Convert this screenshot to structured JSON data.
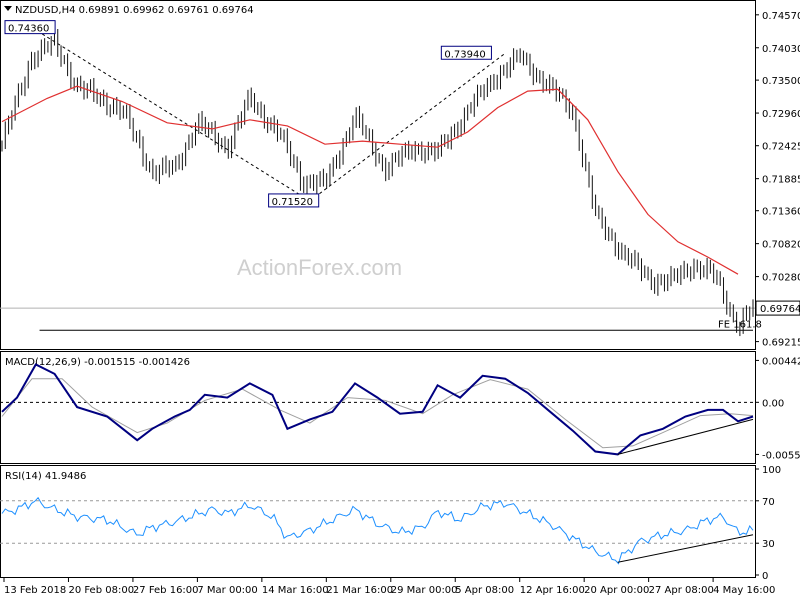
{
  "header": {
    "symbol_line": "NZDUSD,H4  0.69891 0.69962 0.69761 0.69764",
    "arrow_icon": "triangle-down-icon"
  },
  "watermark": "ActionForex.com",
  "chart_data": [
    {
      "type": "candlestick",
      "title": "NZDUSD,H4",
      "ohlc_last": {
        "open": 0.69891,
        "high": 0.69962,
        "low": 0.69761,
        "close": 0.69764
      },
      "y_ticks": [
        "0.74570",
        "0.74030",
        "0.73500",
        "0.72960",
        "0.72425",
        "0.71885",
        "0.71360",
        "0.70820",
        "0.70280",
        "0.69215"
      ],
      "ylim": [
        0.6911,
        0.7478
      ],
      "current_price_label": "0.69764",
      "current_price": 0.69764,
      "annotations": [
        {
          "label": "0.74360",
          "value": 0.7436
        },
        {
          "label": "0.71520",
          "value": 0.7152
        },
        {
          "label": "0.73940",
          "value": 0.7394
        },
        {
          "label": "FE 161.8",
          "value": 0.694
        }
      ],
      "series": [
        {
          "name": "price",
          "color": "#111111"
        },
        {
          "name": "moving average",
          "color": "#e03030"
        }
      ],
      "price_points": [
        [
          0,
          0.7245
        ],
        [
          0.04,
          0.739
        ],
        [
          0.07,
          0.741
        ],
        [
          0.1,
          0.734
        ],
        [
          0.16,
          0.73
        ],
        [
          0.2,
          0.72
        ],
        [
          0.23,
          0.7205
        ],
        [
          0.26,
          0.728
        ],
        [
          0.3,
          0.724
        ],
        [
          0.33,
          0.732
        ],
        [
          0.37,
          0.726
        ],
        [
          0.4,
          0.7185
        ],
        [
          0.43,
          0.718
        ],
        [
          0.47,
          0.729
        ],
        [
          0.51,
          0.7205
        ],
        [
          0.55,
          0.724
        ],
        [
          0.58,
          0.723
        ],
        [
          0.62,
          0.73
        ],
        [
          0.66,
          0.736
        ],
        [
          0.69,
          0.7388
        ],
        [
          0.72,
          0.735
        ],
        [
          0.76,
          0.73
        ],
        [
          0.79,
          0.713
        ],
        [
          0.83,
          0.706
        ],
        [
          0.87,
          0.702
        ],
        [
          0.89,
          0.702
        ],
        [
          0.92,
          0.7048
        ],
        [
          0.95,
          0.7028
        ],
        [
          0.98,
          0.6946
        ],
        [
          1.0,
          0.6976
        ]
      ],
      "ma_points": [
        [
          0,
          0.7282
        ],
        [
          0.06,
          0.732
        ],
        [
          0.1,
          0.734
        ],
        [
          0.16,
          0.7315
        ],
        [
          0.22,
          0.728
        ],
        [
          0.28,
          0.727
        ],
        [
          0.33,
          0.7285
        ],
        [
          0.38,
          0.7275
        ],
        [
          0.43,
          0.7245
        ],
        [
          0.48,
          0.725
        ],
        [
          0.53,
          0.7245
        ],
        [
          0.58,
          0.724
        ],
        [
          0.62,
          0.7265
        ],
        [
          0.66,
          0.7305
        ],
        [
          0.7,
          0.7332
        ],
        [
          0.74,
          0.7335
        ],
        [
          0.78,
          0.7285
        ],
        [
          0.82,
          0.72
        ],
        [
          0.86,
          0.713
        ],
        [
          0.9,
          0.7085
        ],
        [
          0.94,
          0.706
        ],
        [
          0.98,
          0.7032
        ]
      ],
      "trendlines": [
        {
          "from": [
            0.04,
            0.7436
          ],
          "to": [
            0.41,
            0.7152
          ],
          "style": "dashed"
        },
        {
          "from": [
            0.41,
            0.7152
          ],
          "to": [
            0.67,
            0.7394
          ],
          "style": "dashed"
        },
        {
          "from": [
            0.05,
            0.694
          ],
          "to": [
            1.0,
            0.694
          ],
          "style": "solid"
        }
      ]
    },
    {
      "type": "line",
      "title": "MACD(12,26,9) -0.001515 -0.001426",
      "y_ticks": [
        "0.004428",
        "0.00",
        "-0.005506"
      ],
      "ylim": [
        -0.0062,
        0.005
      ],
      "series": [
        {
          "name": "MACD",
          "color": "#000080",
          "points": [
            [
              0,
              -0.001
            ],
            [
              0.02,
              0.0005
            ],
            [
              0.045,
              0.004
            ],
            [
              0.07,
              0.003
            ],
            [
              0.1,
              -0.0005
            ],
            [
              0.14,
              -0.0015
            ],
            [
              0.18,
              -0.004
            ],
            [
              0.2,
              -0.0028
            ],
            [
              0.23,
              -0.0015
            ],
            [
              0.25,
              -0.0008
            ],
            [
              0.27,
              0.0008
            ],
            [
              0.3,
              0.0005
            ],
            [
              0.33,
              0.002
            ],
            [
              0.36,
              0.0008
            ],
            [
              0.38,
              -0.0028
            ],
            [
              0.41,
              -0.0018
            ],
            [
              0.44,
              -0.001
            ],
            [
              0.47,
              0.002
            ],
            [
              0.5,
              0.0005
            ],
            [
              0.53,
              -0.0012
            ],
            [
              0.56,
              -0.001
            ],
            [
              0.58,
              0.0018
            ],
            [
              0.61,
              0.0005
            ],
            [
              0.64,
              0.0028
            ],
            [
              0.67,
              0.0025
            ],
            [
              0.7,
              0.001
            ],
            [
              0.73,
              -0.001
            ],
            [
              0.76,
              -0.003
            ],
            [
              0.79,
              -0.0052
            ],
            [
              0.82,
              -0.0055
            ],
            [
              0.85,
              -0.0035
            ],
            [
              0.88,
              -0.0028
            ],
            [
              0.91,
              -0.0015
            ],
            [
              0.94,
              -0.0008
            ],
            [
              0.96,
              -0.0008
            ],
            [
              0.98,
              -0.002
            ],
            [
              1.0,
              -0.0015
            ]
          ]
        },
        {
          "name": "Signal",
          "color": "#a0a0a0",
          "points": [
            [
              0,
              -0.0015
            ],
            [
              0.04,
              0.0025
            ],
            [
              0.08,
              0.0025
            ],
            [
              0.12,
              -0.0005
            ],
            [
              0.18,
              -0.0032
            ],
            [
              0.22,
              -0.0022
            ],
            [
              0.27,
              0.0002
            ],
            [
              0.32,
              0.0014
            ],
            [
              0.37,
              -0.0008
            ],
            [
              0.41,
              -0.0022
            ],
            [
              0.46,
              0.0005
            ],
            [
              0.51,
              0.0002
            ],
            [
              0.56,
              -0.0012
            ],
            [
              0.6,
              0.0008
            ],
            [
              0.65,
              0.0024
            ],
            [
              0.7,
              0.0014
            ],
            [
              0.75,
              -0.0018
            ],
            [
              0.8,
              -0.0048
            ],
            [
              0.84,
              -0.0046
            ],
            [
              0.88,
              -0.0032
            ],
            [
              0.93,
              -0.0014
            ],
            [
              0.97,
              -0.0012
            ],
            [
              1.0,
              -0.0014
            ]
          ]
        }
      ],
      "trendlines": [
        {
          "from": [
            0.82,
            -0.0055
          ],
          "to": [
            1.0,
            -0.0018
          ],
          "style": "solid"
        }
      ]
    },
    {
      "type": "line",
      "title": "RSI(14) 41.9486",
      "y_ticks": [
        "100",
        "70",
        "30",
        "0"
      ],
      "ylim": [
        0,
        100
      ],
      "series": [
        {
          "name": "RSI",
          "color": "#1e90ff",
          "points": [
            [
              0,
              58
            ],
            [
              0.02,
              62
            ],
            [
              0.045,
              70
            ],
            [
              0.07,
              62
            ],
            [
              0.1,
              55
            ],
            [
              0.14,
              52
            ],
            [
              0.18,
              38
            ],
            [
              0.2,
              45
            ],
            [
              0.23,
              50
            ],
            [
              0.25,
              55
            ],
            [
              0.28,
              62
            ],
            [
              0.3,
              58
            ],
            [
              0.33,
              66
            ],
            [
              0.36,
              55
            ],
            [
              0.38,
              35
            ],
            [
              0.41,
              42
            ],
            [
              0.44,
              52
            ],
            [
              0.47,
              62
            ],
            [
              0.5,
              48
            ],
            [
              0.53,
              40
            ],
            [
              0.56,
              45
            ],
            [
              0.58,
              60
            ],
            [
              0.61,
              52
            ],
            [
              0.64,
              65
            ],
            [
              0.67,
              68
            ],
            [
              0.7,
              58
            ],
            [
              0.73,
              48
            ],
            [
              0.76,
              35
            ],
            [
              0.79,
              22
            ],
            [
              0.82,
              14
            ],
            [
              0.85,
              32
            ],
            [
              0.88,
              38
            ],
            [
              0.91,
              42
            ],
            [
              0.94,
              52
            ],
            [
              0.96,
              55
            ],
            [
              0.98,
              40
            ],
            [
              1.0,
              42
            ]
          ]
        }
      ],
      "trendlines": [
        {
          "from": [
            0.82,
            12
          ],
          "to": [
            1.0,
            38
          ],
          "style": "solid"
        }
      ]
    }
  ],
  "x_axis": {
    "labels": [
      "13 Feb 2018",
      "20 Feb 08:00",
      "27 Feb 16:00",
      "7 Mar 00:00",
      "14 Mar 16:00",
      "21 Mar 16:00",
      "29 Mar 00:00",
      "5 Apr 08:00",
      "12 Apr 16:00",
      "20 Apr 00:00",
      "27 Apr 08:00",
      "4 May 16:00"
    ]
  }
}
